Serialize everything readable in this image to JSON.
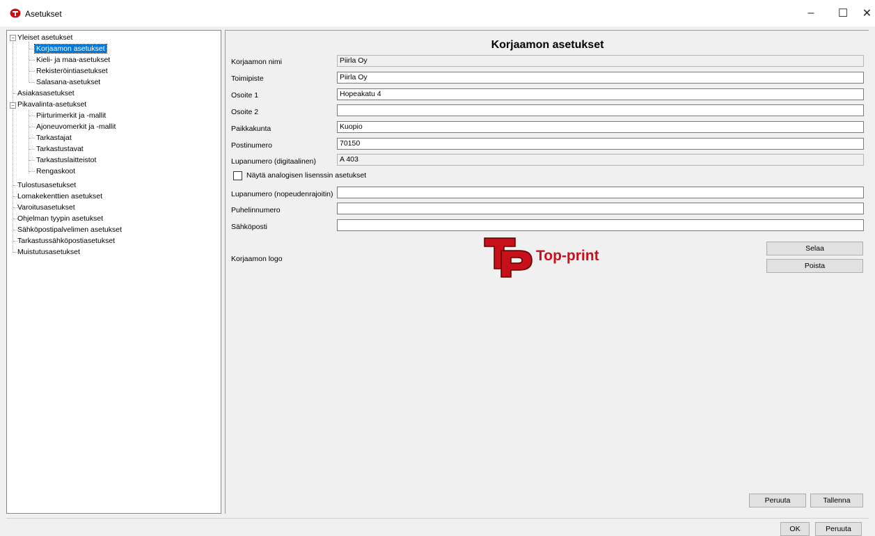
{
  "window": {
    "title": "Asetukset",
    "minimize": "–",
    "maximize": "☐",
    "close": "✕"
  },
  "tree": {
    "items": [
      {
        "label": "Yleiset asetukset",
        "expander": "−"
      },
      {
        "label": "Korjaamon asetukset"
      },
      {
        "label": "Kieli- ja maa-asetukset"
      },
      {
        "label": "Rekisteröintiasetukset"
      },
      {
        "label": "Salasana-asetukset"
      },
      {
        "label": "Asiakasasetukset"
      },
      {
        "label": "Pikavalinta-asetukset",
        "expander": "−"
      },
      {
        "label": "Piirturimerkit ja -mallit"
      },
      {
        "label": "Ajoneuvomerkit ja -mallit"
      },
      {
        "label": "Tarkastajat"
      },
      {
        "label": "Tarkastustavat"
      },
      {
        "label": "Tarkastuslaitteistot"
      },
      {
        "label": "Rengaskoot"
      },
      {
        "label": "Tulostusasetukset"
      },
      {
        "label": "Lomakekenttien asetukset"
      },
      {
        "label": "Varoitusasetukset"
      },
      {
        "label": "Ohjelman tyypin asetukset"
      },
      {
        "label": "Sähköpostipalvelimen asetukset"
      },
      {
        "label": "Tarkastussähköpostiasetukset"
      },
      {
        "label": "Muistutusasetukset"
      }
    ],
    "selected": "Korjaamon asetukset"
  },
  "main": {
    "heading": "Korjaamon asetukset",
    "fields": [
      {
        "label": "Korjaamon nimi",
        "value": "Piirla Oy",
        "readonly": true
      },
      {
        "label": "Toimipiste",
        "value": "Piirla Oy"
      },
      {
        "label": "Osoite 1",
        "value": "Hopeakatu 4"
      },
      {
        "label": "Osoite 2",
        "value": ""
      },
      {
        "label": "Paikkakunta",
        "value": "Kuopio"
      },
      {
        "label": "Postinumero",
        "value": "70150"
      },
      {
        "label": "Lupanumero (digitaalinen)",
        "value": "A 403",
        "readonly": true
      }
    ],
    "checkbox": {
      "label": "Näytä analogisen lisenssin asetukset",
      "checked": false
    },
    "fields2": [
      {
        "label": "Lupanumero (nopeudenrajoitin)",
        "value": ""
      },
      {
        "label": "Puhelinnumero",
        "value": ""
      },
      {
        "label": "Sähköposti",
        "value": ""
      }
    ],
    "logo_label": "Korjaamon logo",
    "logo_text": "Top-print",
    "browse_button": "Selaa",
    "remove_button": "Poista",
    "cancel_button": "Peruuta",
    "save_button": "Tallenna"
  },
  "footer": {
    "ok_button": "OK",
    "cancel_button": "Peruuta"
  },
  "colors": {
    "selection": "#0078d7",
    "logo_red": "#c8101a"
  }
}
